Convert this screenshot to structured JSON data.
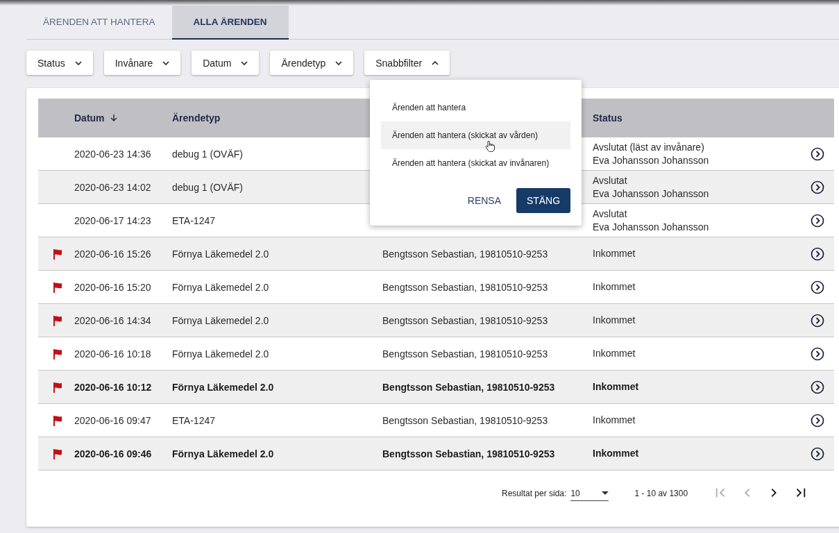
{
  "tabs": [
    {
      "label": "ÄRENDEN ATT HANTERA",
      "selected": false
    },
    {
      "label": "ALLA ÄRENDEN",
      "selected": true
    }
  ],
  "filters": [
    {
      "label": "Status",
      "expanded": false
    },
    {
      "label": "Invånare",
      "expanded": false
    },
    {
      "label": "Datum",
      "expanded": false
    },
    {
      "label": "Ärendetyp",
      "expanded": false
    },
    {
      "label": "Snabbfilter",
      "expanded": true
    }
  ],
  "quick_filter_menu": {
    "options": [
      {
        "label": "Ärenden att hantera",
        "highlighted": false
      },
      {
        "label": "Ärenden att hantera (skickat av vården)",
        "highlighted": true
      },
      {
        "label": "Ärenden att hantera (skickat av invånaren)",
        "highlighted": false
      }
    ],
    "clear_button": "RENSA",
    "close_button": "STÄNG"
  },
  "table": {
    "columns": [
      {
        "kind": "date",
        "label": "Datum",
        "sorted": true
      },
      {
        "kind": "type",
        "label": "Ärendetyp",
        "sorted": false
      },
      {
        "kind": "status",
        "label": "Status",
        "sorted": false
      }
    ],
    "rows": [
      {
        "flagged": false,
        "unread": false,
        "date": "2020-06-23 14:36",
        "type": "debug 1 (OVÄF)",
        "status": [
          "Avslutat (läst av invånare)",
          "Eva Johansson Johansson"
        ]
      },
      {
        "flagged": false,
        "unread": false,
        "date": "2020-06-23 14:02",
        "type": "debug 1 (OVÄF)",
        "status": [
          "Avslutat",
          "Eva Johansson Johansson"
        ]
      },
      {
        "flagged": false,
        "unread": false,
        "date": "2020-06-17 14:23",
        "type": "ETA-1247",
        "status": [
          "Avslutat",
          "Eva Johansson Johansson"
        ]
      },
      {
        "flagged": true,
        "unread": false,
        "date": "2020-06-16 15:26",
        "type": "Förnya Läkemedel 2.0",
        "resident": "Bengtsson Sebastian, 19810510-9253",
        "status": [
          "Inkommet"
        ]
      },
      {
        "flagged": true,
        "unread": false,
        "date": "2020-06-16 15:20",
        "type": "Förnya Läkemedel 2.0",
        "resident": "Bengtsson Sebastian, 19810510-9253",
        "status": [
          "Inkommet"
        ]
      },
      {
        "flagged": true,
        "unread": false,
        "date": "2020-06-16 14:34",
        "type": "Förnya Läkemedel 2.0",
        "resident": "Bengtsson Sebastian, 19810510-9253",
        "status": [
          "Inkommet"
        ]
      },
      {
        "flagged": true,
        "unread": false,
        "date": "2020-06-16 10:18",
        "type": "Förnya Läkemedel 2.0",
        "resident": "Bengtsson Sebastian, 19810510-9253",
        "status": [
          "Inkommet"
        ]
      },
      {
        "flagged": true,
        "unread": true,
        "date": "2020-06-16 10:12",
        "type": "Förnya Läkemedel 2.0",
        "resident": "Bengtsson Sebastian, 19810510-9253",
        "status": [
          "Inkommet"
        ]
      },
      {
        "flagged": true,
        "unread": false,
        "date": "2020-06-16 09:47",
        "type": "ETA-1247",
        "resident": "Bengtsson Sebastian, 19810510-9253",
        "status": [
          "Inkommet"
        ]
      },
      {
        "flagged": true,
        "unread": true,
        "date": "2020-06-16 09:46",
        "type": "Förnya Läkemedel 2.0",
        "resident": "Bengtsson Sebastian, 19810510-9253",
        "status": [
          "Inkommet"
        ]
      }
    ]
  },
  "pagination": {
    "per_page_label": "Resultat per sida:",
    "per_page": "10",
    "range": "1 - 10 av 1300",
    "nav": [
      {
        "kind": "first",
        "disabled": true
      },
      {
        "kind": "prev",
        "disabled": true
      },
      {
        "kind": "next",
        "disabled": false
      },
      {
        "kind": "last",
        "disabled": false
      }
    ]
  }
}
